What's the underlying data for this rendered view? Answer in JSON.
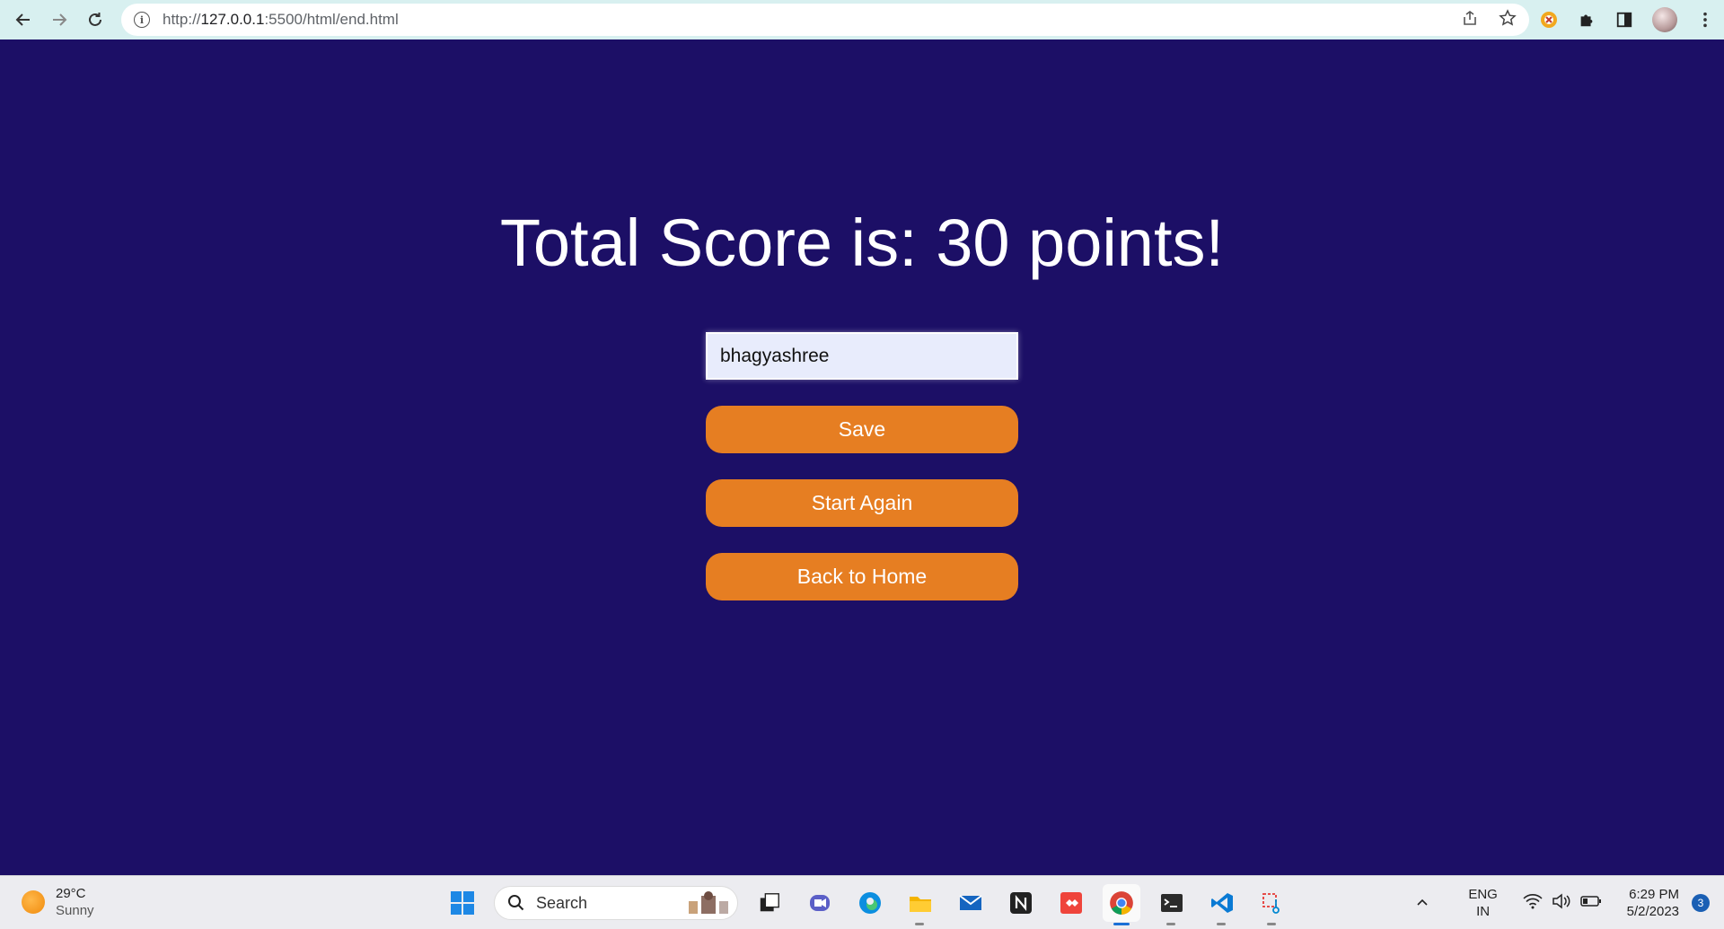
{
  "browser": {
    "url_prefix": "http://",
    "url_host": "127.0.0.1",
    "url_path": ":5500/html/end.html"
  },
  "page": {
    "title": "Total Score is: 30 points!",
    "name_input_value": "bhagyashree",
    "save_label": "Save",
    "start_again_label": "Start Again",
    "back_home_label": "Back to Home"
  },
  "taskbar": {
    "weather_temp": "29°C",
    "weather_desc": "Sunny",
    "search_label": "Search",
    "lang_primary": "ENG",
    "lang_secondary": "IN",
    "time": "6:29 PM",
    "date": "5/2/2023",
    "notification_count": "3"
  },
  "colors": {
    "page_background": "#1c0f66",
    "button": "#e67e22",
    "input_background": "#e8ecfc"
  }
}
